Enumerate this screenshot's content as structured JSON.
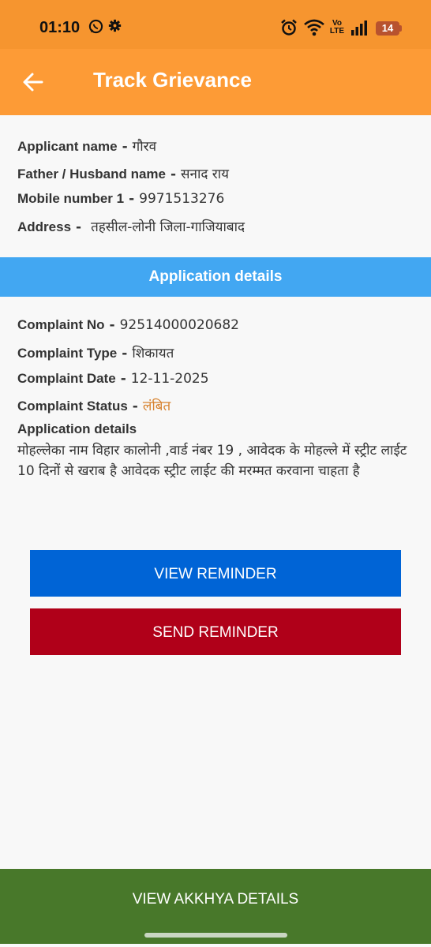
{
  "status_bar": {
    "time": "01:10",
    "battery": "14",
    "network": "Vo LTE",
    "icons": [
      "whatsapp-icon",
      "gear-icon",
      "alarm-icon",
      "wifi-icon",
      "volte-icon",
      "signal-icon",
      "battery-icon"
    ]
  },
  "header": {
    "title": "Track Grievance",
    "back_icon": "arrow-left-icon"
  },
  "applicant": {
    "name_label": "Applicant name",
    "name_value": "गौरव",
    "father_label": "Father / Husband name",
    "father_value": "सनाद राय",
    "mobile_label": "Mobile number 1",
    "mobile_value": "9971513276",
    "address_label": "Address",
    "address_value": "तहसील-लोनी जिला-गाजियाबाद",
    "separator": "-"
  },
  "section": {
    "title": "Application details"
  },
  "complaint": {
    "no_label": "Complaint No",
    "no_value": "92514000020682",
    "type_label": "Complaint Type",
    "type_value": "शिकायत",
    "date_label": "Complaint Date",
    "date_value": "12-11-2025",
    "status_label": "Complaint Status",
    "status_value": "लंबित",
    "details_label": "Application details",
    "details_value": "मोहल्लेका नाम विहार कालोनी ,वार्ड नंबर 19 , आवेदक के मोहल्ले में स्ट्रीट लाईट 10 दिनों से खराब है आवेदक स्ट्रीट लाईट की मरम्मत करवाना चाहता है"
  },
  "buttons": {
    "view_reminder": "VIEW REMINDER",
    "send_reminder": "SEND REMINDER",
    "view_akkhya": "VIEW AKKHYA DETAILS"
  },
  "colors": {
    "status_bar": "#f6952f",
    "app_bar": "#fd9b36",
    "section_header": "#42a7f2",
    "view_reminder": "#0064d6",
    "send_reminder": "#b00019",
    "bottom_button": "#48782a",
    "status_pending": "#d7822e"
  }
}
